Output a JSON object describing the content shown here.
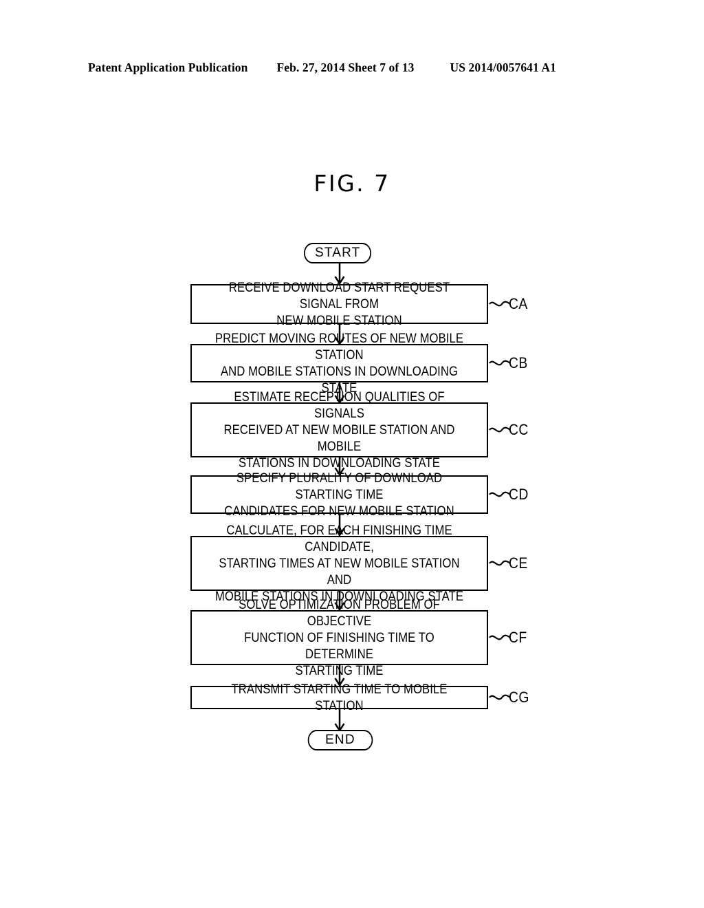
{
  "header": {
    "publication": "Patent Application Publication",
    "date_sheet": "Feb. 27, 2014  Sheet 7 of 13",
    "doc_number": "US 2014/0057641 A1"
  },
  "figure": {
    "title": "FIG. 7"
  },
  "chart_data": {
    "type": "diagram",
    "diagram_kind": "flowchart",
    "title": "FIG. 7",
    "orientation": "top-to-bottom",
    "nodes": [
      {
        "id": "start",
        "shape": "terminal",
        "label": "START",
        "ref": ""
      },
      {
        "id": "CA",
        "shape": "process",
        "label": "RECEIVE DOWNLOAD START REQUEST SIGNAL FROM\nNEW MOBILE STATION",
        "ref": "CA"
      },
      {
        "id": "CB",
        "shape": "process",
        "label": "PREDICT MOVING ROUTES OF NEW MOBILE STATION\nAND MOBILE STATIONS IN DOWNLOADING STATE",
        "ref": "CB"
      },
      {
        "id": "CC",
        "shape": "process",
        "label": "ESTIMATE RECEPTION QUALITIES OF SIGNALS\nRECEIVED AT NEW MOBILE STATION AND MOBILE\nSTATIONS IN DOWNLOADING STATE",
        "ref": "CC"
      },
      {
        "id": "CD",
        "shape": "process",
        "label": "SPECIFY PLURALITY OF DOWNLOAD STARTING TIME\nCANDIDATES FOR NEW MOBILE STATION",
        "ref": "CD"
      },
      {
        "id": "CE",
        "shape": "process",
        "label": "CALCULATE, FOR EACH FINISHING TIME CANDIDATE,\nSTARTING TIMES AT NEW MOBILE STATION AND\nMOBILE STATIONS IN DOWNLOADING STATE",
        "ref": "CE"
      },
      {
        "id": "CF",
        "shape": "process",
        "label": "SOLVE OPTIMIZATION PROBLEM OF OBJECTIVE\nFUNCTION OF  FINISHING TIME TO DETERMINE\nSTARTING TIME",
        "ref": "CF"
      },
      {
        "id": "CG",
        "shape": "process",
        "label": "TRANSMIT STARTING TIME TO MOBILE STATION",
        "ref": "CG"
      },
      {
        "id": "end",
        "shape": "terminal",
        "label": "END",
        "ref": ""
      }
    ],
    "edges": [
      {
        "from": "start",
        "to": "CA"
      },
      {
        "from": "CA",
        "to": "CB"
      },
      {
        "from": "CB",
        "to": "CC"
      },
      {
        "from": "CC",
        "to": "CD"
      },
      {
        "from": "CD",
        "to": "CE"
      },
      {
        "from": "CE",
        "to": "CF"
      },
      {
        "from": "CF",
        "to": "CG"
      },
      {
        "from": "CG",
        "to": "end"
      }
    ]
  },
  "flowchart": {
    "start": {
      "label": "START"
    },
    "end": {
      "label": "END"
    },
    "steps": [
      {
        "label": "RECEIVE DOWNLOAD START REQUEST SIGNAL FROM\nNEW MOBILE STATION",
        "ref": "CA"
      },
      {
        "label": "PREDICT MOVING ROUTES OF NEW MOBILE STATION\nAND MOBILE STATIONS IN DOWNLOADING STATE",
        "ref": "CB"
      },
      {
        "label": "ESTIMATE RECEPTION QUALITIES OF SIGNALS\nRECEIVED AT NEW MOBILE STATION AND MOBILE\nSTATIONS IN DOWNLOADING STATE",
        "ref": "CC"
      },
      {
        "label": "SPECIFY PLURALITY OF DOWNLOAD STARTING TIME\nCANDIDATES FOR NEW MOBILE STATION",
        "ref": "CD"
      },
      {
        "label": "CALCULATE, FOR EACH FINISHING TIME CANDIDATE,\nSTARTING TIMES AT NEW MOBILE STATION AND\nMOBILE STATIONS IN DOWNLOADING STATE",
        "ref": "CE"
      },
      {
        "label": "SOLVE OPTIMIZATION PROBLEM OF OBJECTIVE\nFUNCTION OF  FINISHING TIME TO DETERMINE\nSTARTING TIME",
        "ref": "CF"
      },
      {
        "label": "TRANSMIT STARTING TIME TO MOBILE STATION",
        "ref": "CG"
      }
    ]
  }
}
